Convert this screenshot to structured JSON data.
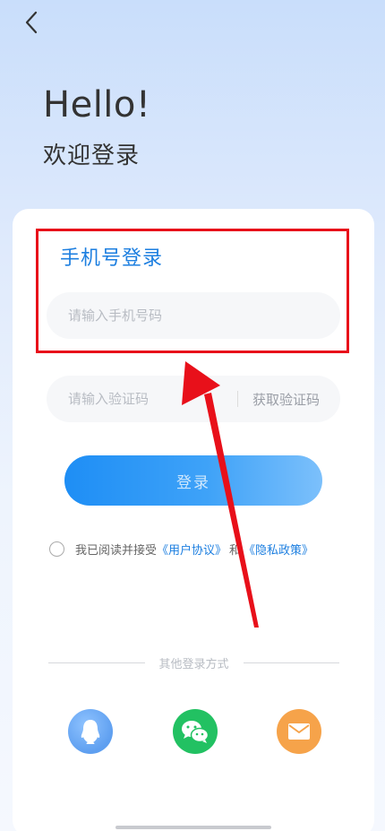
{
  "header": {
    "back_icon": "chevron-left-icon"
  },
  "hero": {
    "title": "Hello!",
    "subtitle": "欢迎登录"
  },
  "login_form": {
    "title": "手机号登录",
    "phone_input": {
      "placeholder": "请输入手机号码",
      "value": ""
    },
    "code_input": {
      "placeholder": "请输入验证码",
      "value": ""
    },
    "get_code_label": "获取验证码",
    "submit_label": "登录"
  },
  "agreement": {
    "checked": false,
    "prefix": "我已阅读并接受",
    "user_agreement": "《用户协议》",
    "conjunction": "和",
    "privacy_policy": "《隐私政策》"
  },
  "other_login": {
    "label": "其他登录方式",
    "options": [
      {
        "icon": "qq-icon",
        "color": "#5e9ff0"
      },
      {
        "icon": "wechat-icon",
        "color": "#22c162"
      },
      {
        "icon": "mail-icon",
        "color": "#f6a34a"
      }
    ]
  },
  "annotation": {
    "highlight_color": "#e8101a",
    "arrow_color": "#e8101a"
  }
}
